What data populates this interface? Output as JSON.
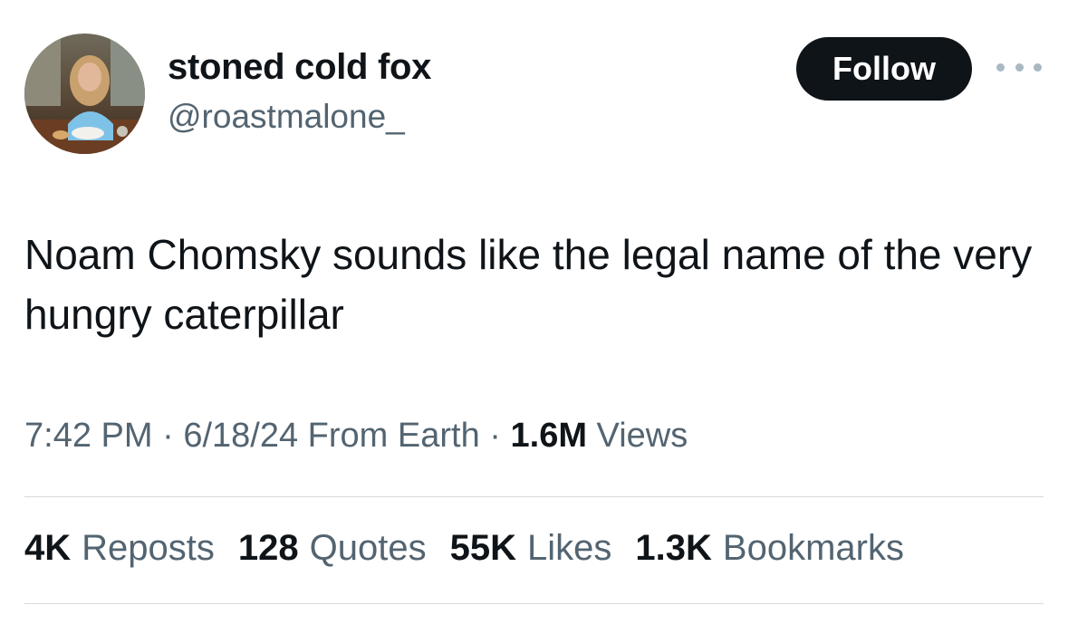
{
  "user": {
    "display_name": "stoned cold fox",
    "handle": "@roastmalone_",
    "avatar_icon": "profile-photo"
  },
  "actions": {
    "follow_label": "Follow",
    "more_icon": "more-horizontal-icon"
  },
  "tweet": {
    "text": "Noam Chomsky sounds like the legal name of the very hungry caterpillar"
  },
  "meta": {
    "time": "7:42 PM",
    "separator": "·",
    "date": "6/18/24",
    "source": "From Earth",
    "views_count": "1.6M",
    "views_label": "Views"
  },
  "stats": [
    {
      "count": "4K",
      "label": "Reposts"
    },
    {
      "count": "128",
      "label": "Quotes"
    },
    {
      "count": "55K",
      "label": "Likes"
    },
    {
      "count": "1.3K",
      "label": "Bookmarks"
    }
  ],
  "colors": {
    "text_primary": "#0f1419",
    "text_secondary": "#536471",
    "button_bg": "#0f1419",
    "button_text": "#ffffff",
    "divider": "#d9d9d9"
  }
}
